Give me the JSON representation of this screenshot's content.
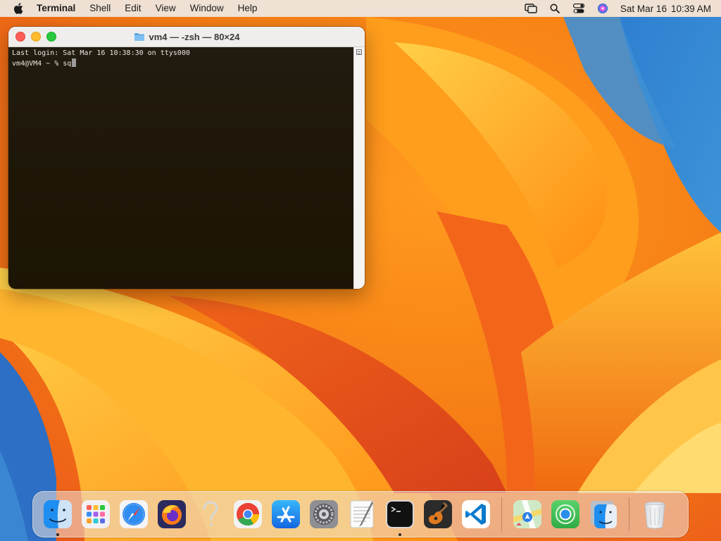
{
  "menubar": {
    "apple_icon": "apple-logo-icon",
    "app_name": "Terminal",
    "menus": [
      "Shell",
      "Edit",
      "View",
      "Window",
      "Help"
    ],
    "status_icons": [
      "screen-mirroring-icon",
      "spotlight-search-icon",
      "control-center-icon",
      "siri-icon"
    ],
    "date": "Sat Mar 16",
    "time": "10:39 AM"
  },
  "terminal_window": {
    "title": "vm4 — -zsh — 80×24",
    "title_icon": "folder-icon",
    "lines": [
      "Last login: Sat Mar 16 10:38:30 on ttys000",
      "vm4@VM4 ~ % sq"
    ]
  },
  "dock": {
    "apps": [
      {
        "name": "Finder",
        "icon": "finder-icon",
        "running": true
      },
      {
        "name": "Launchpad",
        "icon": "launchpad-icon",
        "running": false
      },
      {
        "name": "Safari",
        "icon": "safari-icon",
        "running": false
      },
      {
        "name": "Firefox",
        "icon": "firefox-icon",
        "running": false
      },
      {
        "name": "Unknown App",
        "icon": "question-mark-icon",
        "running": false
      },
      {
        "name": "Google Chrome",
        "icon": "chrome-icon",
        "running": false
      },
      {
        "name": "App Store",
        "icon": "app-store-icon",
        "running": false
      },
      {
        "name": "System Settings",
        "icon": "system-settings-icon",
        "running": false
      },
      {
        "name": "TextEdit",
        "icon": "textedit-icon",
        "running": false
      },
      {
        "name": "Terminal",
        "icon": "terminal-icon",
        "running": true
      },
      {
        "name": "GarageBand",
        "icon": "garageband-icon",
        "running": false
      },
      {
        "name": "Visual Studio Code",
        "icon": "vscode-icon",
        "running": false
      }
    ],
    "extras": [
      {
        "name": "Maps",
        "icon": "maps-icon"
      },
      {
        "name": "Find My",
        "icon": "find-my-icon"
      },
      {
        "name": "Finder Document",
        "icon": "finder-document-icon"
      }
    ],
    "trash": {
      "name": "Trash",
      "icon": "trash-icon"
    }
  }
}
